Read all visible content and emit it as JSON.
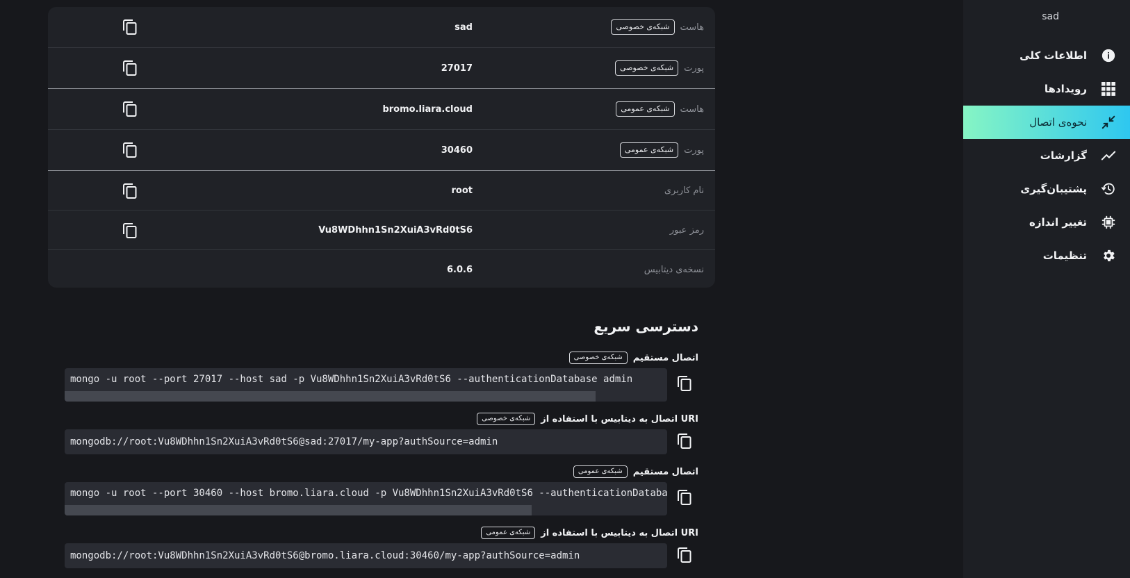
{
  "sidebar": {
    "title": "sad",
    "items": [
      {
        "label": "اطلاعات کلی",
        "icon": "info-icon",
        "active": false
      },
      {
        "label": "رویدادها",
        "icon": "grid-icon",
        "active": false
      },
      {
        "label": "نحوه‌ی اتصال",
        "icon": "compress-icon",
        "active": true
      },
      {
        "label": "گزارشات",
        "icon": "chart-line-icon",
        "active": false
      },
      {
        "label": "پشتیبان‌گیری",
        "icon": "history-icon",
        "active": false
      },
      {
        "label": "تغییر اندازه",
        "icon": "chip-icon",
        "active": false
      },
      {
        "label": "تنظیمات",
        "icon": "gear-icon",
        "active": false
      }
    ]
  },
  "info": {
    "rows": [
      {
        "label": "هاست",
        "badge": "شبکه‌ی خصوصی",
        "value": "sad",
        "copy": true
      },
      {
        "label": "پورت",
        "badge": "شبکه‌ی خصوصی",
        "value": "27017",
        "copy": true
      },
      {
        "label": "هاست",
        "badge": "شبکه‌ی عمومی",
        "value": "bromo.liara.cloud",
        "copy": true
      },
      {
        "label": "پورت",
        "badge": "شبکه‌ی عمومی",
        "value": "30460",
        "copy": true
      },
      {
        "label": "نام کاربری",
        "badge": "",
        "value": "root",
        "copy": true
      },
      {
        "label": "رمز عبور",
        "badge": "",
        "value": "Vu8WDhhn1Sn2XuiA3vRd0tS6",
        "copy": true
      },
      {
        "label": "نسخه‌ی دیتابیس",
        "badge": "",
        "value": "6.0.6",
        "copy": false
      }
    ]
  },
  "quick_access": {
    "title": "دسترسی سریع",
    "blocks": [
      {
        "heading": "اتصال مستقیم",
        "badge": "شبکه‌ی خصوصی",
        "code": "mongo -u root --port 27017 --host sad -p Vu8WDhhn1Sn2XuiA3vRd0tS6 --authenticationDatabase admin",
        "scroll_fraction": 0.88
      },
      {
        "heading": "اتصال به دیتابیس با استفاده از URI",
        "badge": "شبکه‌ی خصوصی",
        "code": "mongodb://root:Vu8WDhhn1Sn2XuiA3vRd0tS6@sad:27017/my-app?authSource=admin",
        "scroll_fraction": null
      },
      {
        "heading": "اتصال مستقیم",
        "badge": "شبکه‌ی عمومی",
        "code": "mongo -u root --port 30460 --host bromo.liara.cloud -p Vu8WDhhn1Sn2XuiA3vRd0tS6 --authenticationDatabase admin",
        "scroll_fraction": 0.77
      },
      {
        "heading": "اتصال به دیتابیس با استفاده از URI",
        "badge": "شبکه‌ی عمومی",
        "code": "mongodb://root:Vu8WDhhn1Sn2XuiA3vRd0tS6@bromo.liara.cloud:30460/my-app?authSource=admin",
        "scroll_fraction": null
      }
    ]
  }
}
